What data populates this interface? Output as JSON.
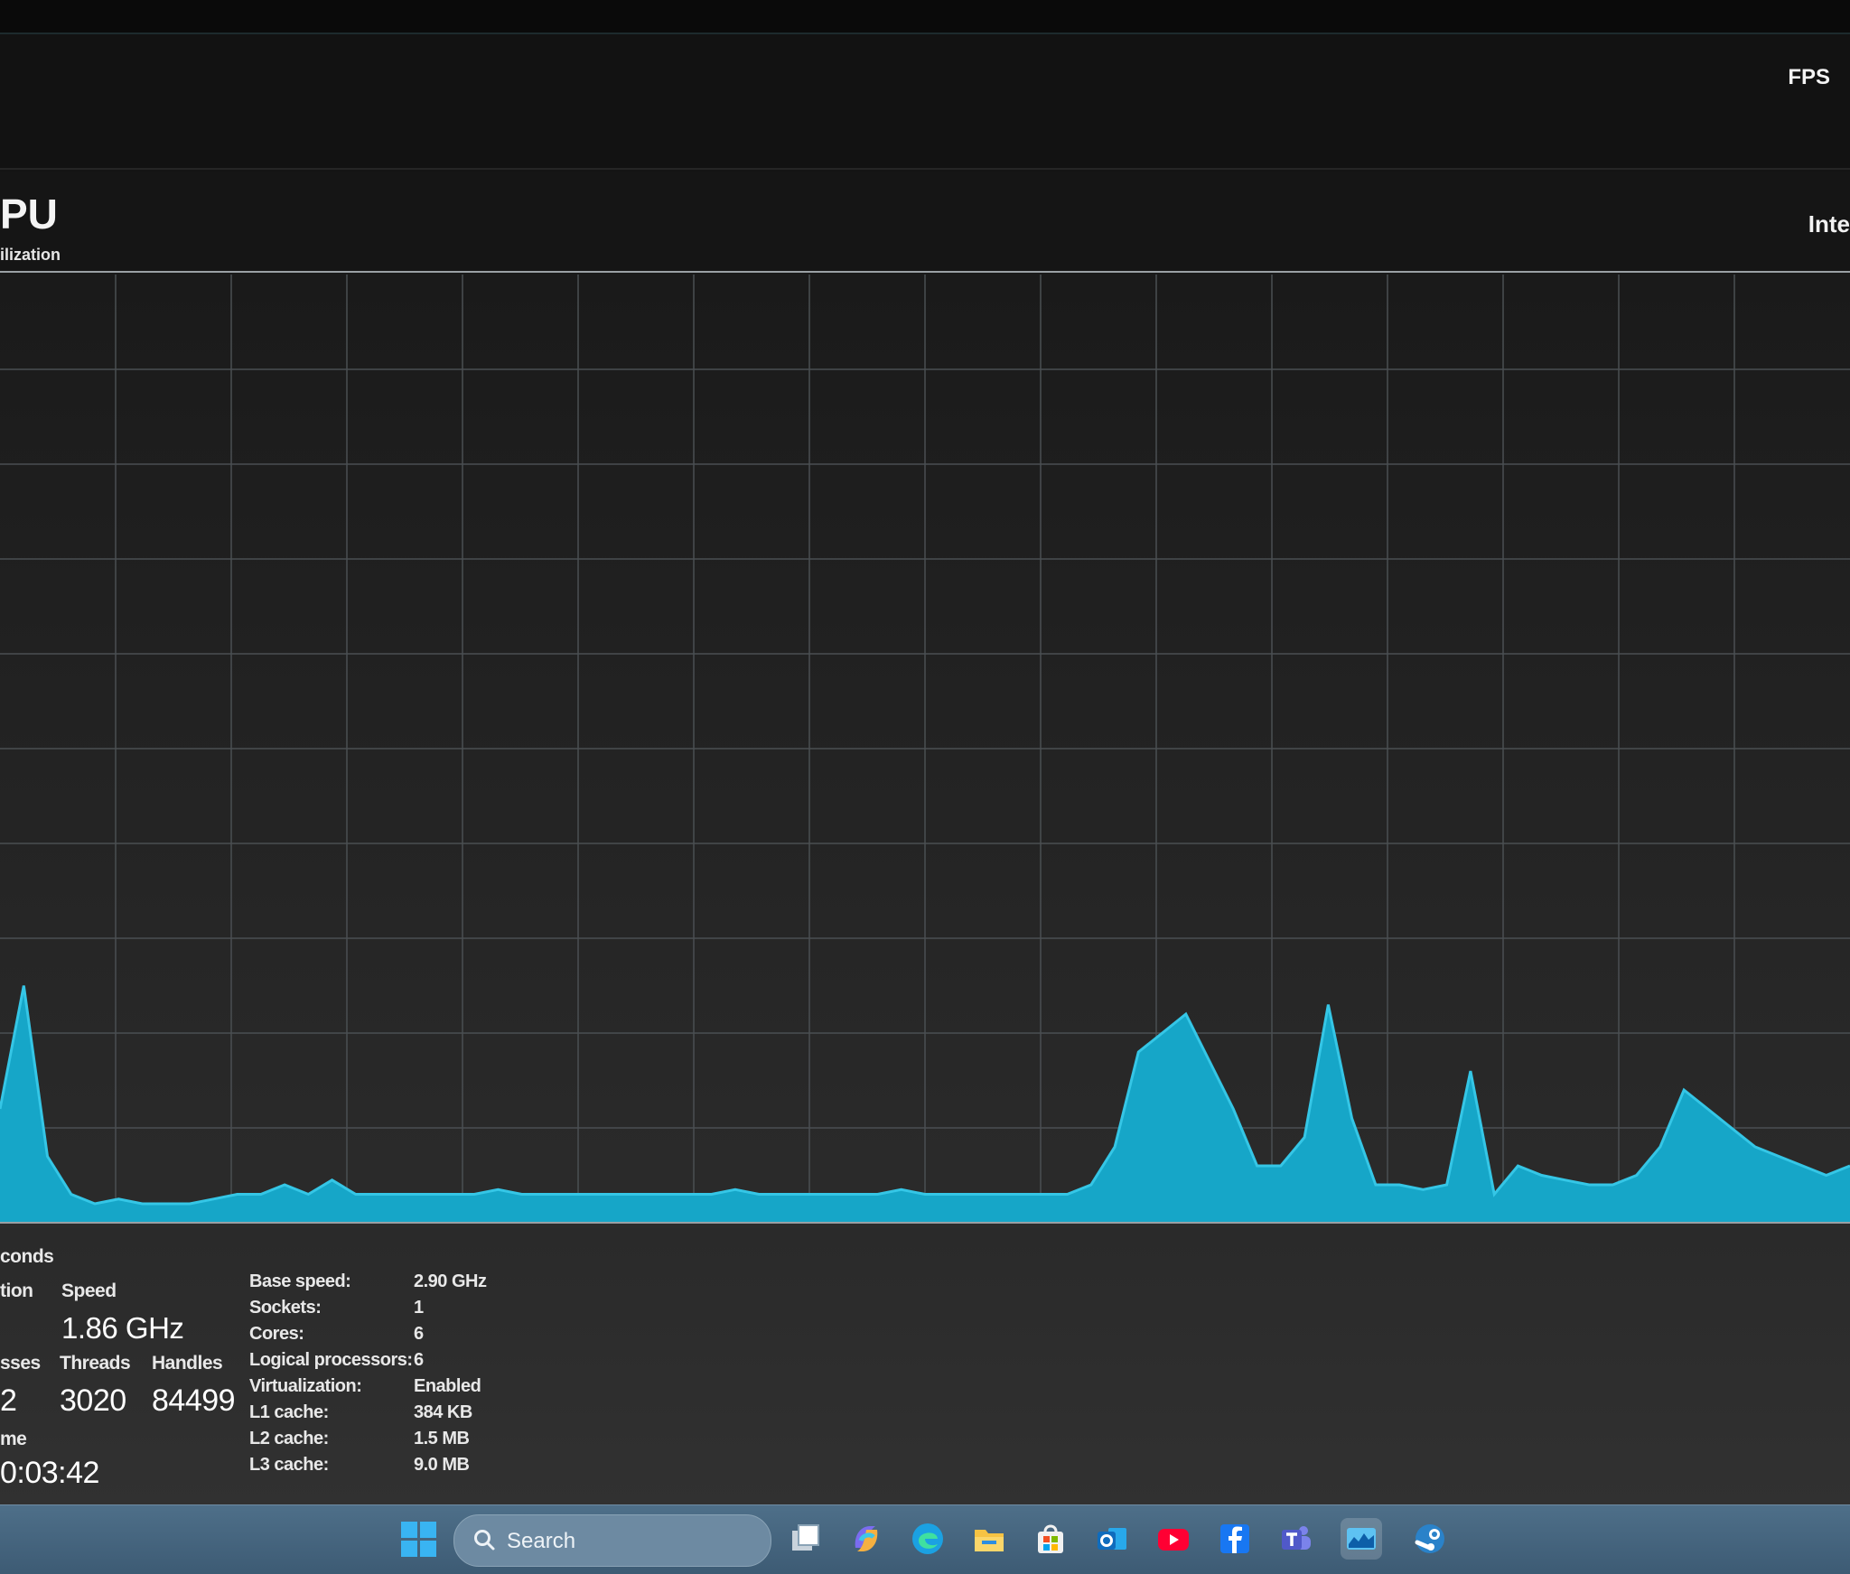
{
  "overlay": {
    "fps_label": "FPS"
  },
  "header": {
    "title": "PU",
    "subtitle": "ilization",
    "model_fragment": "Inte"
  },
  "graph": {
    "footer_label": "conds",
    "line_color": "#35c6e6",
    "fill_color": "#16a6c8"
  },
  "chart_data": {
    "type": "area",
    "ylim": [
      0,
      100
    ],
    "grid": true,
    "series": [
      {
        "values": [
          12,
          25,
          7,
          3,
          2,
          2.5,
          2,
          2,
          2,
          2.5,
          3,
          3,
          4,
          3,
          4.5,
          3,
          3,
          3,
          3,
          3,
          3,
          3.5,
          3,
          3,
          3,
          3,
          3,
          3,
          3,
          3,
          3,
          3.5,
          3,
          3,
          3,
          3,
          3,
          3,
          3.5,
          3,
          3,
          3,
          3,
          3,
          3,
          3,
          4,
          8,
          18,
          20,
          22,
          17,
          12,
          6,
          6,
          9,
          23,
          11,
          4,
          4,
          3.5,
          4,
          16,
          3,
          6,
          5,
          4.5,
          4,
          4,
          5,
          8,
          14,
          12,
          10,
          8,
          7,
          6,
          5,
          6
        ]
      }
    ]
  },
  "stats": {
    "utilization_label": "tion",
    "speed_label": "Speed",
    "speed_value": "1.86 GHz",
    "processes_label": "sses",
    "processes_value": "2",
    "threads_label": "Threads",
    "threads_value": "3020",
    "handles_label": "Handles",
    "handles_value": "84499",
    "uptime_label": "me",
    "uptime_value": "0:03:42",
    "specs": [
      {
        "label": "Base speed:",
        "value": "2.90 GHz"
      },
      {
        "label": "Sockets:",
        "value": "1"
      },
      {
        "label": "Cores:",
        "value": "6"
      },
      {
        "label": "Logical processors:",
        "value": "6"
      },
      {
        "label": "Virtualization:",
        "value": "Enabled"
      },
      {
        "label": "L1 cache:",
        "value": "384 KB"
      },
      {
        "label": "L2 cache:",
        "value": "1.5 MB"
      },
      {
        "label": "L3 cache:",
        "value": "9.0 MB"
      }
    ]
  },
  "taskbar": {
    "search_placeholder": "Search",
    "icons": [
      "windows-start-icon",
      "task-view-icon",
      "copilot-icon",
      "edge-icon",
      "file-explorer-icon",
      "microsoft-store-icon",
      "outlook-icon",
      "youtube-icon",
      "facebook-icon",
      "teams-icon",
      "task-manager-icon",
      "steam-icon"
    ]
  }
}
